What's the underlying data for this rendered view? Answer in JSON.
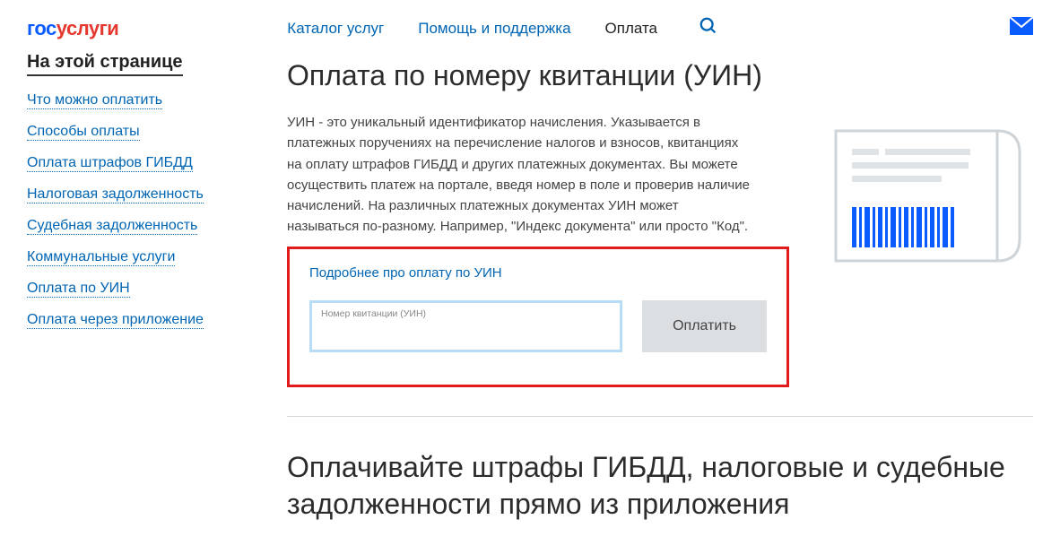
{
  "header": {
    "logo_part1": "гос",
    "logo_part2": "услуги",
    "nav": {
      "catalog": "Каталог услуг",
      "help": "Помощь и поддержка",
      "payment": "Оплата"
    }
  },
  "sidebar": {
    "title": "На этой странице",
    "links": [
      "Что можно оплатить",
      "Способы оплаты",
      "Оплата штрафов ГИБДД",
      "Налоговая задолженность",
      "Судебная задолженность",
      "Коммунальные услуги",
      "Оплата по УИН",
      "Оплата через приложение"
    ]
  },
  "main": {
    "title": "Оплата по номеру квитанции (УИН)",
    "description": "УИН - это уникальный идентификатор начисления. Указывается в платежных поручениях на перечисление налогов и взносов, квитанциях на оплату штрафов ГИБДД и других платежных документах. Вы можете осуществить платеж на портале, введя номер в поле и проверив наличие начислений. На различных платежных документах УИН может называться по-разному. Например, \"Индекс документа\" или просто \"Код\".",
    "more_link": "Подробнее про оплату по УИН",
    "input_label": "Номер квитанции (УИН)",
    "pay_button": "Оплатить",
    "secondary_title": "Оплачивайте штрафы ГИБДД, налоговые и судебные задолженности прямо из приложения"
  }
}
